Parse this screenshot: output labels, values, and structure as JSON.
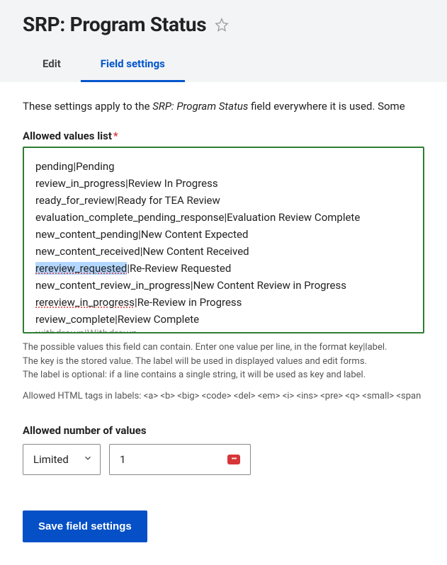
{
  "header": {
    "title": "SRP: Program Status"
  },
  "tabs": {
    "edit": "Edit",
    "field_settings": "Field settings"
  },
  "intro": {
    "prefix": "These settings apply to the ",
    "field_name": "SRP: Program Status",
    "suffix": " field everywhere it is used. Some "
  },
  "allowed_values": {
    "label": "Allowed values list",
    "lines": [
      {
        "text": "pending|Pending"
      },
      {
        "text": "review_in_progress|Review In Progress"
      },
      {
        "text": "ready_for_review|Ready for TEA Review"
      },
      {
        "text": "evaluation_complete_pending_response|Evaluation Review Complete"
      },
      {
        "text": "new_content_pending|New Content Expected"
      },
      {
        "text": "new_content_received|New Content Received"
      },
      {
        "key": "rereview_requested",
        "sep": "|",
        "label": "Re-Review Requested",
        "highlighted": true
      },
      {
        "text": "new_content_review_in_progress|New Content Review in Progress"
      },
      {
        "key": "rereview_in_progress",
        "sep": "|",
        "label": "Re-Review in Progress",
        "spellcheck": true
      },
      {
        "text": "review_complete|Review Complete"
      },
      {
        "text": "withdrawn|Withdrawn",
        "cut": true
      }
    ],
    "help_line1": "The possible values this field can contain. Enter one value per line, in the format key|label.",
    "help_line2": "The key is the stored value. The label will be used in displayed values and edit forms.",
    "help_line3": "The label is optional: if a line contains a single string, it will be used as key and label.",
    "allowed_tags": "Allowed HTML tags in labels: <a> <b> <big> <code> <del> <em> <i> <ins> <pre> <q> <small> <span"
  },
  "number_of_values": {
    "label": "Allowed number of values",
    "select_value": "Limited",
    "input_value": "1",
    "badge": "•••"
  },
  "save_button": "Save field settings"
}
